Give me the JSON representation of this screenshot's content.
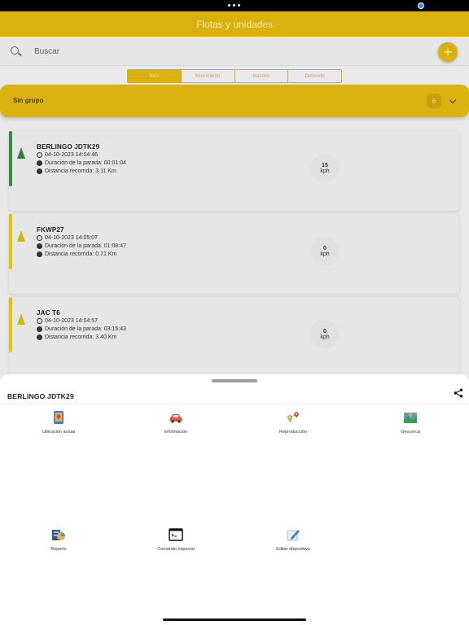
{
  "header": {
    "title": "Flotas y unidades"
  },
  "search": {
    "placeholder": "Buscar"
  },
  "add_button": {
    "label": "+"
  },
  "tabs": [
    {
      "label": "Todo",
      "active": true
    },
    {
      "label": "Movimiento",
      "active": false
    },
    {
      "label": "Inactivo",
      "active": false
    },
    {
      "label": "Detenido",
      "active": false
    }
  ],
  "group": {
    "label": "Sin grupo",
    "count": "6"
  },
  "vehicles": [
    {
      "name": "BERLINGO JDTK29",
      "timestamp": "04-10-2023 14:04:46",
      "stop_duration": "Duración de la parada: 00:01:04",
      "distance": "Distancia recorrida: 3.11 Km",
      "speed": "15",
      "speed_unit": "kph",
      "status_color": "#2f8f3e"
    },
    {
      "name": "FKWP27",
      "timestamp": "04-10-2023 14:05:07",
      "stop_duration": "Duración de la parada: 01:08:47",
      "distance": "Distancia recorrida: 0.71 Km",
      "speed": "0",
      "speed_unit": "kph",
      "status_color": "#d8c70e"
    },
    {
      "name": "JAC T6",
      "timestamp": "04-10-2023 14:04:57",
      "stop_duration": "Duración de la parada: 03:15:43",
      "distance": "Distancia recorrida: 3.40 Km",
      "speed": "0",
      "speed_unit": "kph",
      "status_color": "#d8c70e"
    }
  ],
  "sheet": {
    "title": "BERLINGO JDTK29",
    "actions": [
      {
        "label": "Ubicación actual",
        "icon": "phone-location-icon"
      },
      {
        "label": "Información",
        "icon": "car-icon"
      },
      {
        "label": "Reproducción",
        "icon": "route-pins-icon"
      },
      {
        "label": "Geocerca",
        "icon": "map-icon"
      },
      {
        "label": "Reporte",
        "icon": "report-chart-icon"
      },
      {
        "label": "Comando especial",
        "icon": "terminal-icon"
      },
      {
        "label": "Editar dispositivo",
        "icon": "edit-icon"
      }
    ]
  },
  "colors": {
    "accent": "#dbb10f",
    "moving": "#2f8f3e",
    "idle": "#d8c70e"
  }
}
